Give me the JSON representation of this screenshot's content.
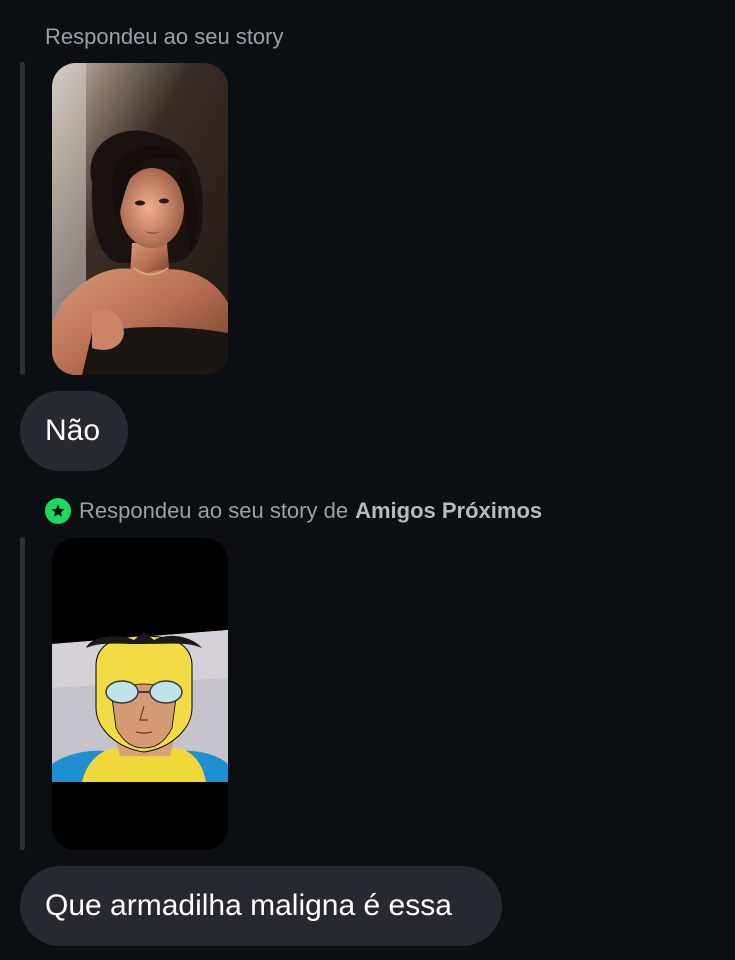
{
  "messages": [
    {
      "reply_label": "Respondeu ao seu story",
      "story_thumbnail": "portrait-photo-woman",
      "text": "Não"
    },
    {
      "reply_label": "Respondeu ao seu story de",
      "reply_label_bold": "Amigos Próximos",
      "close_friends_icon": "green-star-icon",
      "story_thumbnail": "cartoon-hero-screenshot",
      "text": "Que armadilha maligna é essa"
    }
  ],
  "colors": {
    "background": "#0b0f14",
    "bubble": "#262a30",
    "label": "#9aa0a6",
    "close_friends_green": "#1ed760"
  }
}
